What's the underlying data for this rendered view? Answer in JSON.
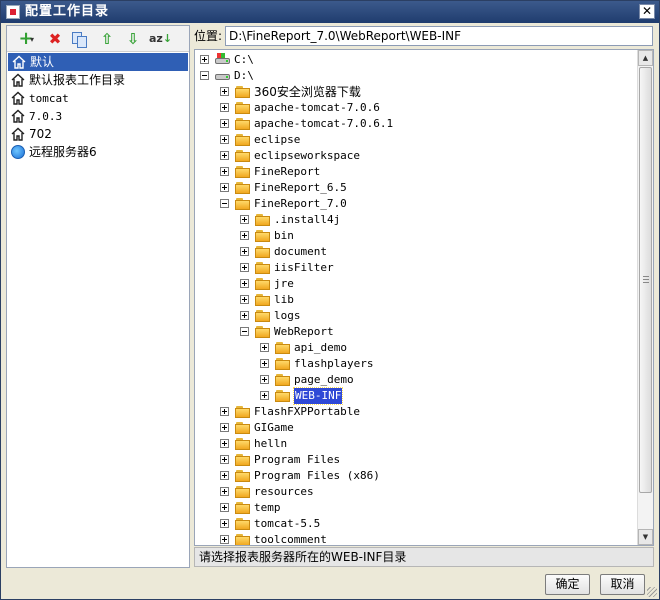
{
  "window": {
    "title": "配置工作目录",
    "close_symbol": "✕"
  },
  "toolbar": {
    "add_symbol": "+",
    "add_dropdown_symbol": "▾",
    "delete_symbol": "✖",
    "up_symbol": "⇧",
    "down_symbol": "⇩",
    "sort_az": "az",
    "sort_arrow": "↓"
  },
  "left_list": {
    "items": [
      {
        "label": "默认",
        "selected": true,
        "icon": "home-icon"
      },
      {
        "label": "默认报表工作目录",
        "selected": false,
        "icon": "home-icon"
      },
      {
        "label": "tomcat",
        "selected": false,
        "icon": "home-icon"
      },
      {
        "label": "7.0.3",
        "selected": false,
        "icon": "home-icon"
      },
      {
        "label": "702",
        "selected": false,
        "icon": "home-icon"
      },
      {
        "label": "远程服务器6",
        "selected": false,
        "icon": "globe-icon"
      }
    ]
  },
  "location": {
    "label": "位置:",
    "value": "D:\\FineReport_7.0\\WebReport\\WEB-INF"
  },
  "tree": {
    "nodes": [
      {
        "label": "C:\\",
        "depth": 0,
        "expanded": false,
        "kind": "drive"
      },
      {
        "label": "D:\\",
        "depth": 0,
        "expanded": true,
        "kind": "drive"
      },
      {
        "label": "360安全浏览器下载",
        "depth": 1,
        "expanded": false,
        "kind": "folder",
        "cn": true
      },
      {
        "label": "apache-tomcat-7.0.6",
        "depth": 1,
        "expanded": false,
        "kind": "folder"
      },
      {
        "label": "apache-tomcat-7.0.6.1",
        "depth": 1,
        "expanded": false,
        "kind": "folder"
      },
      {
        "label": "eclipse",
        "depth": 1,
        "expanded": false,
        "kind": "folder"
      },
      {
        "label": "eclipseworkspace",
        "depth": 1,
        "expanded": false,
        "kind": "folder"
      },
      {
        "label": "FineReport",
        "depth": 1,
        "expanded": false,
        "kind": "folder"
      },
      {
        "label": "FineReport_6.5",
        "depth": 1,
        "expanded": false,
        "kind": "folder"
      },
      {
        "label": "FineReport_7.0",
        "depth": 1,
        "expanded": true,
        "kind": "folder"
      },
      {
        "label": ".install4j",
        "depth": 2,
        "expanded": false,
        "kind": "folder"
      },
      {
        "label": "bin",
        "depth": 2,
        "expanded": false,
        "kind": "folder"
      },
      {
        "label": "document",
        "depth": 2,
        "expanded": false,
        "kind": "folder"
      },
      {
        "label": "iisFilter",
        "depth": 2,
        "expanded": false,
        "kind": "folder"
      },
      {
        "label": "jre",
        "depth": 2,
        "expanded": false,
        "kind": "folder"
      },
      {
        "label": "lib",
        "depth": 2,
        "expanded": false,
        "kind": "folder"
      },
      {
        "label": "logs",
        "depth": 2,
        "expanded": false,
        "kind": "folder"
      },
      {
        "label": "WebReport",
        "depth": 2,
        "expanded": true,
        "kind": "folder"
      },
      {
        "label": "api_demo",
        "depth": 3,
        "expanded": false,
        "kind": "folder"
      },
      {
        "label": "flashplayers",
        "depth": 3,
        "expanded": false,
        "kind": "folder"
      },
      {
        "label": "page_demo",
        "depth": 3,
        "expanded": false,
        "kind": "folder"
      },
      {
        "label": "WEB-INF",
        "depth": 3,
        "expanded": false,
        "kind": "folder",
        "selected": true
      },
      {
        "label": "FlashFXPPortable",
        "depth": 1,
        "expanded": false,
        "kind": "folder"
      },
      {
        "label": "GIGame",
        "depth": 1,
        "expanded": false,
        "kind": "folder"
      },
      {
        "label": "helln",
        "depth": 1,
        "expanded": false,
        "kind": "folder"
      },
      {
        "label": "Program Files",
        "depth": 1,
        "expanded": false,
        "kind": "folder"
      },
      {
        "label": "Program Files (x86)",
        "depth": 1,
        "expanded": false,
        "kind": "folder"
      },
      {
        "label": "resources",
        "depth": 1,
        "expanded": false,
        "kind": "folder"
      },
      {
        "label": "temp",
        "depth": 1,
        "expanded": false,
        "kind": "folder"
      },
      {
        "label": "tomcat-5.5",
        "depth": 1,
        "expanded": false,
        "kind": "folder"
      },
      {
        "label": "toolcomment",
        "depth": 1,
        "expanded": false,
        "kind": "folder"
      }
    ]
  },
  "scrollbar": {
    "up_symbol": "▲",
    "down_symbol": "▼"
  },
  "status": {
    "text": "请选择报表服务器所在的WEB-INF目录"
  },
  "buttons": {
    "ok": "确定",
    "cancel": "取消"
  },
  "colors": {
    "title_bar": "#1f3c6e",
    "selection": "#2f5fb5",
    "folder": "#f0a820"
  }
}
